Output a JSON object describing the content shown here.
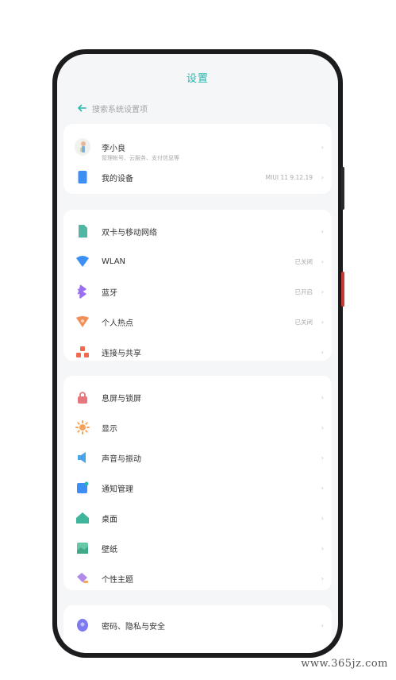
{
  "header": {
    "title": "设置"
  },
  "search": {
    "placeholder": "搜索系统设置项"
  },
  "account": {
    "name": "李小良",
    "subtitle": "管理帐号、云服务、支付信息等"
  },
  "device": {
    "label": "我的设备",
    "value": "MIUI 11 9.12.19"
  },
  "network_items": [
    {
      "label": "双卡与移动网络",
      "value": "",
      "icon": "sim-card-icon",
      "color": "#4fb7a3"
    },
    {
      "label": "WLAN",
      "value": "已关闭",
      "icon": "wifi-icon",
      "color": "#3e8ff3"
    },
    {
      "label": "蓝牙",
      "value": "已开启",
      "icon": "bluetooth-icon",
      "color": "#9a6ff0"
    },
    {
      "label": "个人热点",
      "value": "已关闭",
      "icon": "hotspot-icon",
      "color": "#f08f58"
    },
    {
      "label": "连接与共享",
      "value": "",
      "icon": "share-icon",
      "color": "#f06a52"
    }
  ],
  "display_items": [
    {
      "label": "息屏与锁屏",
      "icon": "lock-icon",
      "color": "#e5767e"
    },
    {
      "label": "显示",
      "icon": "sun-icon",
      "color": "#f5a25a"
    },
    {
      "label": "声音与振动",
      "icon": "speaker-icon",
      "color": "#4aa4e8"
    },
    {
      "label": "通知管理",
      "icon": "notification-icon",
      "color": "#3e8ff3"
    },
    {
      "label": "桌面",
      "icon": "home-icon",
      "color": "#3fb59b"
    },
    {
      "label": "壁纸",
      "icon": "wallpaper-icon",
      "color": "#63c7a8"
    },
    {
      "label": "个性主题",
      "icon": "theme-icon",
      "color": "#b18ae8"
    }
  ],
  "security_items": [
    {
      "label": "密码、隐私与安全",
      "icon": "privacy-icon",
      "color": "#7d7af0"
    }
  ],
  "chevron": "›",
  "watermark": "www.365jz.com",
  "colors": {
    "accent": "#2bb5b0",
    "frame": "#1c1c1e",
    "power_button": "#c93a34"
  }
}
